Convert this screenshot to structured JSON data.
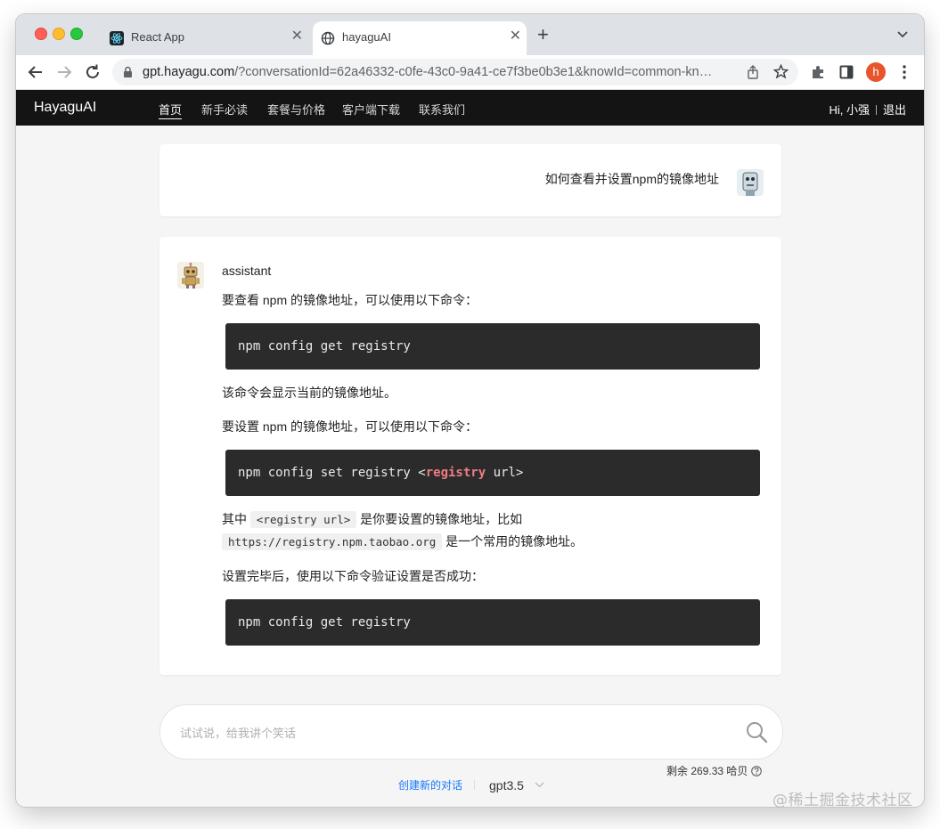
{
  "browser": {
    "tabs": [
      {
        "title": "React App",
        "favicon": "react-icon"
      },
      {
        "title": "hayaguAI",
        "favicon": "globe-icon"
      }
    ],
    "new_tab_label": "+",
    "url_host": "gpt.hayagu.com",
    "url_rest": "/?conversationId=62a46332-c0fe-43c0-9a41-ce7f3be0b3e1&knowId=common-kn…",
    "profile_initial": "h",
    "profile_color": "#e8542c"
  },
  "app": {
    "brand": "HayaguAI",
    "nav": [
      "首页",
      "新手必读",
      "套餐与价格",
      "客户端下载",
      "联系我们"
    ],
    "greeting": "Hi, 小强",
    "logout": "退出"
  },
  "conversation": {
    "question": "如何查看并设置npm的镜像地址",
    "assistant_role": "assistant",
    "intro1": "要查看 npm 的镜像地址，可以使用以下命令：",
    "code1": "npm config get registry",
    "text1": "该命令会显示当前的镜像地址。",
    "intro2": "要设置 npm 的镜像地址，可以使用以下命令：",
    "code2_prefix": "npm config set registry <",
    "code2_keyword": "registry",
    "code2_suffix": " url>",
    "text2_a": "其中 ",
    "inline1": "<registry url>",
    "text2_b": " 是你要设置的镜像地址，比如",
    "inline2": "https://registry.npm.taobao.org",
    "text2_c": " 是一个常用的镜像地址。",
    "intro3": "设置完毕后，使用以下命令验证设置是否成功：",
    "code3": "npm config get registry"
  },
  "composer": {
    "placeholder": "试试说，给我讲个笑话",
    "balance": "剩余 269.33 哈贝",
    "new_chat": "创建新的对话",
    "model": "gpt3.5"
  },
  "watermark": "@稀土掘金技术社区",
  "colors": {
    "appbar": "#141414",
    "link": "#1677ff",
    "code_bg": "#2b2b2b",
    "code_keyword": "#ef7b85"
  }
}
